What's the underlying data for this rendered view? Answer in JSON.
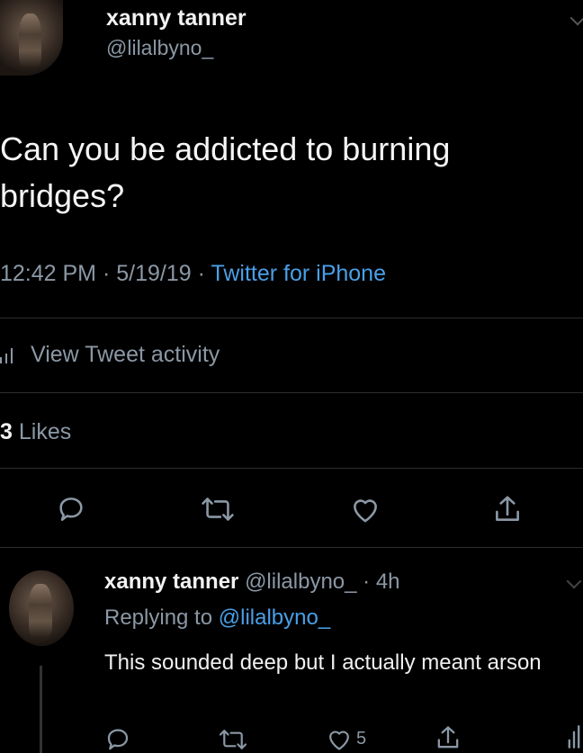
{
  "tweet": {
    "author_name": "xanny tanner",
    "author_handle": "@lilalbyno_",
    "text": "Can you be addicted to burning bridges?",
    "time": "12:42 PM",
    "date": "5/19/19",
    "separator": "·",
    "source": "Twitter for iPhone",
    "activity_label": "View Tweet activity",
    "likes_count": "3",
    "likes_label": "Likes"
  },
  "reply": {
    "author_name": "xanny tanner",
    "author_handle": "@lilalbyno_",
    "age": "· 4h",
    "replying_to_label": "Replying to",
    "replying_to_handle": "@lilalbyno_",
    "text": "This sounded deep but I actually meant arson",
    "like_count": "5"
  },
  "icons": {
    "reply": "reply-icon",
    "retweet": "retweet-icon",
    "like": "heart-icon",
    "share": "share-icon",
    "analytics": "analytics-icon"
  },
  "colors": {
    "background": "#000000",
    "link": "#4a9fe8",
    "muted": "#8b98a5",
    "text": "#f2f2f2"
  }
}
